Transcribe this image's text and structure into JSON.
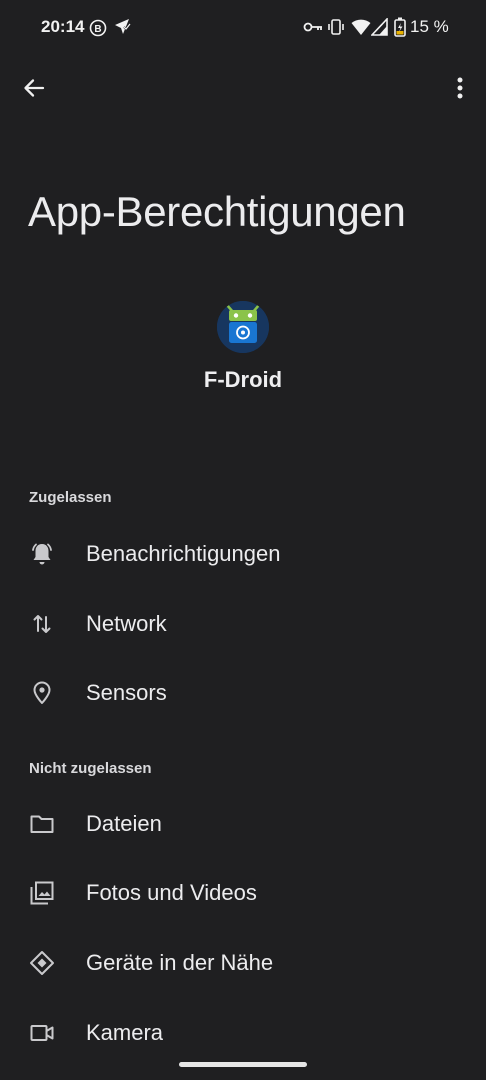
{
  "status_bar": {
    "time": "20:14",
    "battery_percent": "15 %",
    "icons": [
      "b-badge-icon",
      "location-shield-icon",
      "vpn-key-icon",
      "vibrate-icon",
      "wifi-icon",
      "signal-icon",
      "battery-charging-icon"
    ]
  },
  "app_bar": {
    "back_icon": "arrow-back-icon",
    "more_icon": "more-vert-icon"
  },
  "page": {
    "title": "App-Berechtigungen"
  },
  "app": {
    "name": "F-Droid",
    "icon": "fdroid-logo",
    "colors": {
      "background": "#17365f",
      "robot": "#8bc34a",
      "screen": "#1976d2"
    }
  },
  "sections": {
    "allowed": {
      "header": "Zugelassen",
      "items": [
        {
          "label": "Benachrichtigungen",
          "icon": "notification-bell-icon"
        },
        {
          "label": "Network",
          "icon": "swap-vert-icon"
        },
        {
          "label": "Sensors",
          "icon": "location-pin-icon"
        }
      ]
    },
    "not_allowed": {
      "header": "Nicht zugelassen",
      "items": [
        {
          "label": "Dateien",
          "icon": "folder-icon"
        },
        {
          "label": "Fotos und Videos",
          "icon": "photo-library-icon"
        },
        {
          "label": "Geräte in der Nähe",
          "icon": "nearby-devices-icon"
        },
        {
          "label": "Kamera",
          "icon": "camera-icon"
        }
      ]
    }
  },
  "theme": {
    "background": "#1f1f21",
    "text": "#ececee",
    "icon": "#c9c9cc"
  }
}
